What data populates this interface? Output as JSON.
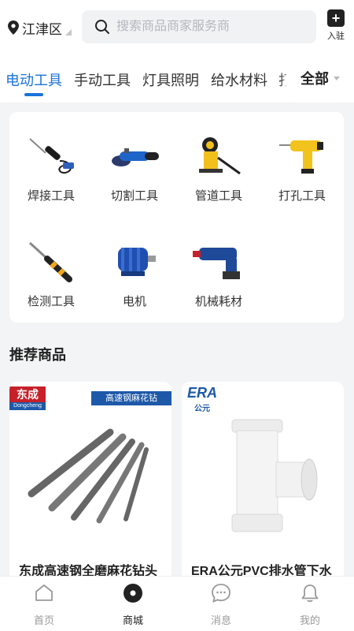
{
  "header": {
    "location": "江津区",
    "search_placeholder": "搜索商品商家服务商",
    "join_label": "入驻"
  },
  "tabs": [
    {
      "label": "电动工具",
      "active": true
    },
    {
      "label": "手动工具",
      "active": false
    },
    {
      "label": "灯具照明",
      "active": false
    },
    {
      "label": "给水材料",
      "active": false
    },
    {
      "label": "打",
      "active": false
    }
  ],
  "tab_all_label": "全部",
  "categories": [
    {
      "label": "焊接工具",
      "icon": "soldering-iron-icon"
    },
    {
      "label": "切割工具",
      "icon": "angle-grinder-icon"
    },
    {
      "label": "管道工具",
      "icon": "pipe-threader-icon"
    },
    {
      "label": "打孔工具",
      "icon": "drill-icon"
    },
    {
      "label": "检测工具",
      "icon": "test-pen-icon"
    },
    {
      "label": "电机",
      "icon": "electric-motor-icon"
    },
    {
      "label": "机械耗材",
      "icon": "rotary-hammer-icon"
    }
  ],
  "recommend_title": "推荐商品",
  "products": [
    {
      "name": "东成高速钢全磨麻花钻头",
      "brand": "东成",
      "brand_en": "Dongcheng",
      "banner": "高速钢麻花钻"
    },
    {
      "name": "ERA公元PVC排水管下水",
      "brand": "ERA",
      "brand_cn": "公元"
    }
  ],
  "bottom_nav": [
    {
      "label": "首页",
      "active": false
    },
    {
      "label": "商城",
      "active": true
    },
    {
      "label": "消息",
      "active": false
    },
    {
      "label": "我的",
      "active": false
    }
  ],
  "colors": {
    "accent": "#1a73d9",
    "brand_red": "#c8202a",
    "brand_blue": "#1d59a8"
  }
}
